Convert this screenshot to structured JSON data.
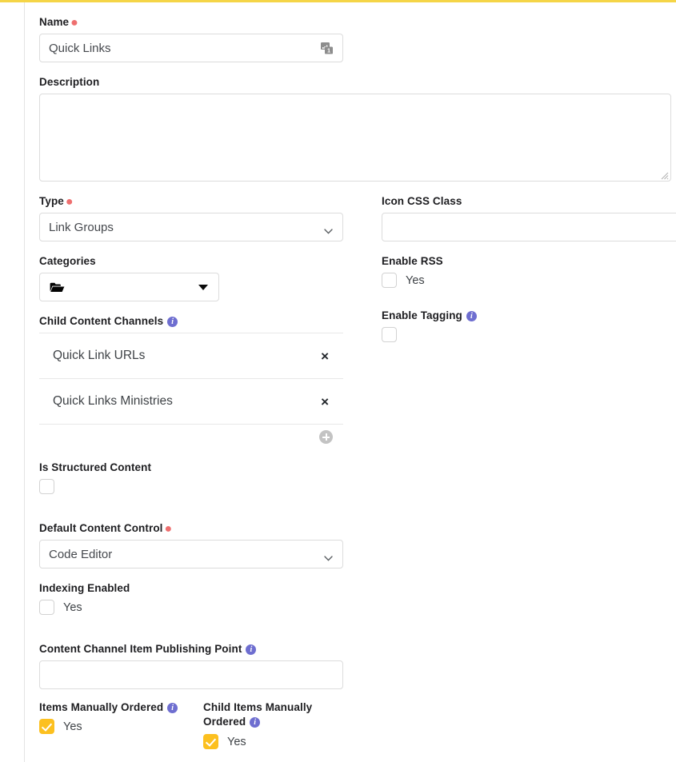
{
  "theme": {
    "accent_gold": "#f5d547",
    "checkbox_checked": "#fcc01f",
    "required_marker": "#ee6f6f",
    "info_icon": "#6e6ed0",
    "border": "#dcdcdc"
  },
  "form": {
    "name": {
      "label": "Name",
      "required": true,
      "value": "Quick Links",
      "placeholder": "",
      "badge_icon": "multi-language-icon",
      "badge_count": "1"
    },
    "description": {
      "label": "Description",
      "value": "",
      "placeholder": ""
    },
    "type": {
      "label": "Type",
      "required": true,
      "value": "Link Groups",
      "options": [
        "Link Groups"
      ]
    },
    "icon_css_class": {
      "label": "Icon CSS Class",
      "value": "",
      "placeholder": ""
    },
    "categories": {
      "label": "Categories",
      "value": "",
      "icon": "folder-open-icon"
    },
    "enable_rss": {
      "label": "Enable RSS",
      "checkbox_label": "Yes",
      "checked": false
    },
    "child_content_channels": {
      "label": "Child Content Channels",
      "has_info": true,
      "items": [
        {
          "name": "Quick Link URLs",
          "remove_label": "×"
        },
        {
          "name": "Quick Links Ministries",
          "remove_label": "×"
        }
      ],
      "add_label": "+"
    },
    "enable_tagging": {
      "label": "Enable Tagging",
      "has_info": true,
      "checkbox_label": "",
      "checked": false
    },
    "is_structured_content": {
      "label": "Is Structured Content",
      "checkbox_label": "",
      "checked": false
    },
    "default_content_control": {
      "label": "Default Content Control",
      "required": true,
      "value": "Code Editor",
      "options": [
        "Code Editor"
      ]
    },
    "indexing_enabled": {
      "label": "Indexing Enabled",
      "checkbox_label": "Yes",
      "checked": false
    },
    "publishing_point": {
      "label": "Content Channel Item Publishing Point",
      "has_info": true,
      "value": "",
      "placeholder": ""
    },
    "items_manually_ordered": {
      "label": "Items Manually Ordered",
      "has_info": true,
      "checkbox_label": "Yes",
      "checked": true
    },
    "child_items_manually_ordered": {
      "label": "Child Items Manually Ordered",
      "has_info": true,
      "checkbox_label": "Yes",
      "checked": true
    }
  }
}
